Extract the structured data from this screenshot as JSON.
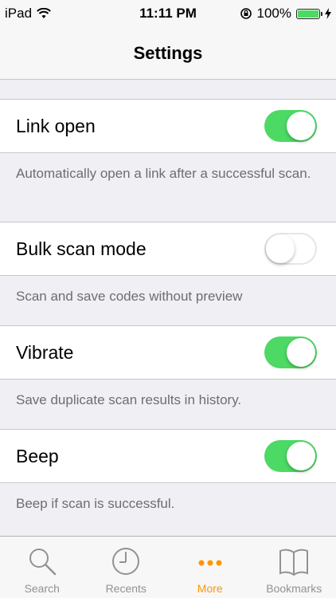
{
  "status_bar": {
    "device": "iPad",
    "time": "11:11 PM",
    "battery": "100%",
    "battery_color": "#4cd964"
  },
  "navbar": {
    "title": "Settings"
  },
  "settings": [
    {
      "label": "Link open",
      "on": true,
      "footer": "Automatically open a link after a successful scan."
    },
    {
      "label": "Bulk scan mode",
      "on": false,
      "footer": "Scan and save codes without preview"
    },
    {
      "label": "Vibrate",
      "on": true,
      "footer": "Save duplicate scan results in history."
    },
    {
      "label": "Beep",
      "on": true,
      "footer": "Beep if scan is successful."
    }
  ],
  "tabbar": {
    "items": [
      {
        "label": "Search",
        "icon": "search-icon",
        "active": false
      },
      {
        "label": "Recents",
        "icon": "clock-icon",
        "active": false
      },
      {
        "label": "More",
        "icon": "more-dots-icon",
        "active": true
      },
      {
        "label": "Bookmarks",
        "icon": "book-icon",
        "active": false
      }
    ]
  },
  "colors": {
    "accent": "#ff9500",
    "toggle_on": "#4cd964"
  }
}
